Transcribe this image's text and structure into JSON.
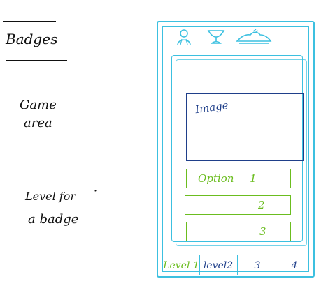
{
  "notes": {
    "badges": "Badges",
    "game_area_line1": "Game",
    "game_area_line2": "area",
    "level_line1": "Level for",
    "level_dot": "·",
    "level_line2": "a badge"
  },
  "toolbar": {
    "icons": [
      "profile-icon",
      "trophy-icon",
      "ship-icon"
    ]
  },
  "game": {
    "image_placeholder": "Image",
    "options": [
      "Option 1",
      "2",
      "3"
    ]
  },
  "levels": [
    "Level 1",
    "level2",
    "3",
    "4"
  ],
  "colors": {
    "frame": "#3cc0e0",
    "image": "#1f3f8a",
    "option": "#6bbd1f"
  }
}
